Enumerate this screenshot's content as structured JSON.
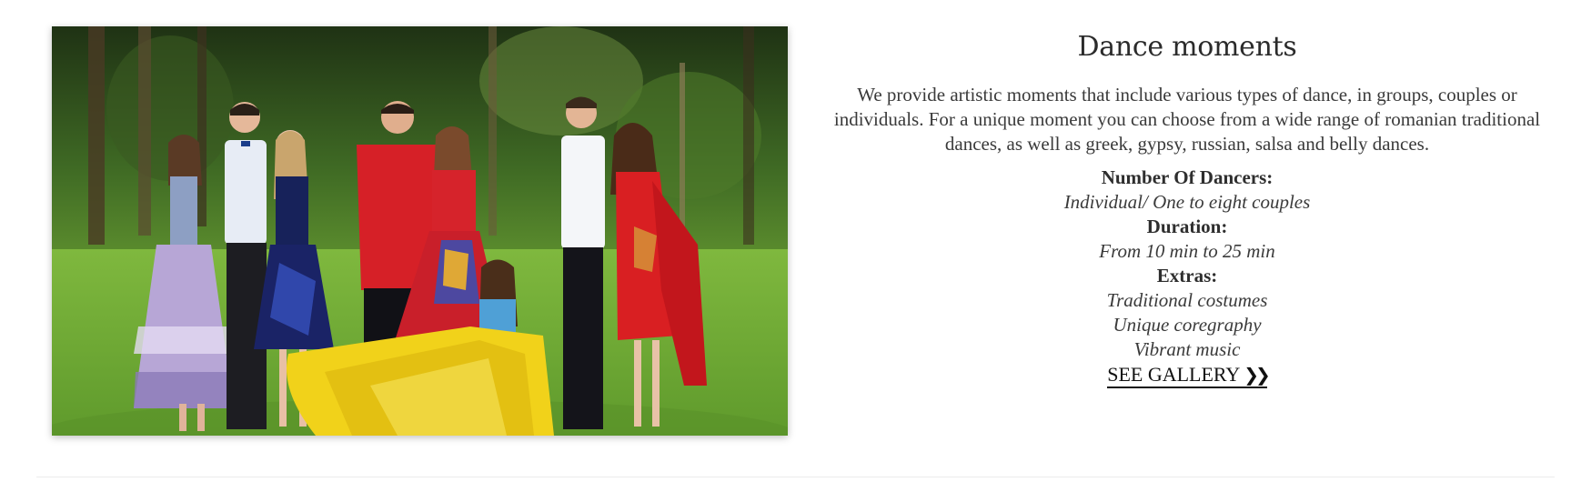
{
  "section": {
    "title": "Dance moments",
    "description": "We provide artistic moments that include various types of dance, in groups, couples or individuals. For a unique moment you can choose from a wide range of romanian traditional dances, as well as greek, gypsy, russian, salsa and belly dances.",
    "details": [
      {
        "label": "Number Of Dancers:",
        "values": [
          "Individual/ One to eight couples"
        ]
      },
      {
        "label": "Duration:",
        "values": [
          "From 10 min to 25 min"
        ]
      },
      {
        "label": "Extras:",
        "values": [
          "Traditional costumes",
          "Unique coregraphy",
          "Vibrant music"
        ]
      }
    ],
    "gallery_link": "SEE GALLERY",
    "gallery_icon": "double-chevron-right-icon"
  },
  "colors": {
    "text": "#333333",
    "link": "#111111",
    "grass": "#6fae3a",
    "forest": "#2f4a1c"
  }
}
